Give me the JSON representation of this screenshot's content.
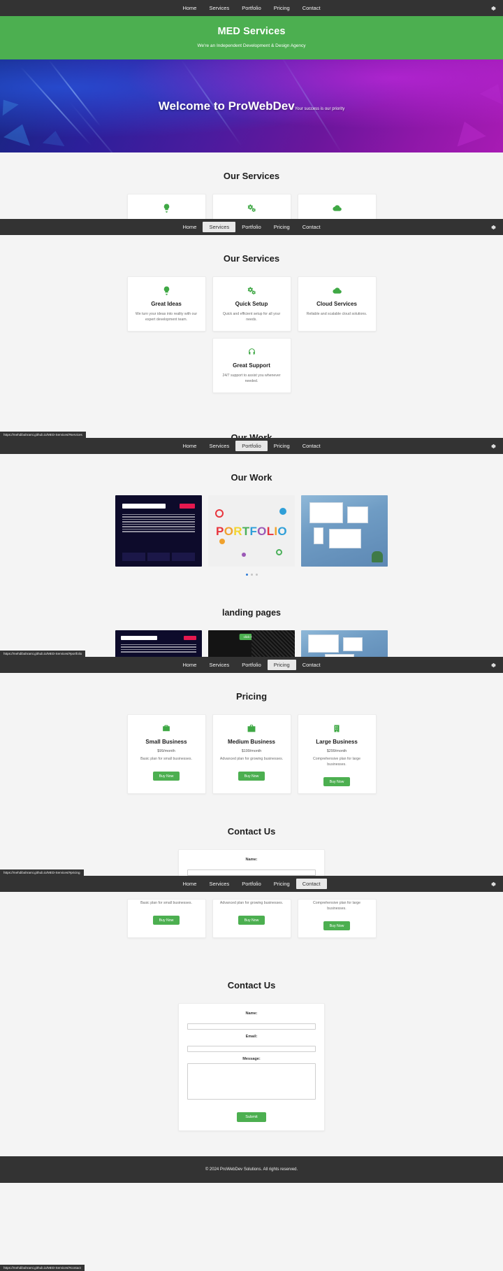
{
  "nav": {
    "items": [
      {
        "label": "Home"
      },
      {
        "label": "Services"
      },
      {
        "label": "Portfolio"
      },
      {
        "label": "Pricing"
      },
      {
        "label": "Contact"
      }
    ],
    "gear_icon": "gear-icon"
  },
  "header": {
    "title": "MED Services",
    "tagline": "We're an Independent Development & Design Agency"
  },
  "hero": {
    "title": "Welcome to ProWebDev",
    "subtitle": "Your success is our priority"
  },
  "services": {
    "title": "Our Services",
    "cards": [
      {
        "icon": "lightbulb-icon",
        "title": "Great Ideas",
        "text": "We turn your ideas into reality with our expert development team."
      },
      {
        "icon": "gears-icon",
        "title": "Quick Setup",
        "text": "Quick and efficient setup for all your needs."
      },
      {
        "icon": "cloud-icon",
        "title": "Cloud Services",
        "text": "Reliable and scalable cloud solutions."
      },
      {
        "icon": "headset-icon",
        "title": "Great Support",
        "text": "24/7 support to assist you whenever needed."
      }
    ]
  },
  "portfolio": {
    "title": "Our Work",
    "landing_title": "landing pages",
    "items": [
      {
        "name": "dark-website-thumbnail"
      },
      {
        "name": "portfolio-letters-thumbnail"
      },
      {
        "name": "desk-devices-thumbnail"
      }
    ],
    "carousel_dots": 3,
    "active_dot": 0,
    "landing_overlay_label": "click to see"
  },
  "pricing": {
    "title": "Pricing",
    "plans": [
      {
        "icon": "briefcase-icon",
        "name": "Small Business",
        "price": "$99/month",
        "desc": "Basic plan for small businesses.",
        "cta": "Buy Now"
      },
      {
        "icon": "suitcase-icon",
        "name": "Medium Business",
        "price": "$199/month",
        "desc": "Advanced plan for growing businesses.",
        "cta": "Buy Now"
      },
      {
        "icon": "building-icon",
        "name": "Large Business",
        "price": "$299/month",
        "desc": "Comprehensive plan for large businesses.",
        "cta": "Buy Now"
      }
    ]
  },
  "contact": {
    "title": "Contact Us",
    "name_label": "Name:",
    "email_label": "Email:",
    "message_label": "Message:",
    "name_value": "",
    "email_value": "",
    "message_value": "",
    "submit": "Submit"
  },
  "footer": {
    "text": "© 2024 ProWebDev Solutions. All rights reserved."
  },
  "status_bars": [
    {
      "url": "https://mehdibahrami.github.io/MED-Services/#services"
    },
    {
      "url": "https://mehdibahrami.github.io/MED-Services/#portfolio"
    },
    {
      "url": "https://mehdibahrami.github.io/MED-Services/#pricing"
    },
    {
      "url": "https://mehdibahrami.github.io/MED-Services/#contact"
    }
  ],
  "colors": {
    "nav_bg": "#333333",
    "brand_green": "#4caf50",
    "icon_green": "#3fa845",
    "page_bg": "#f4f4f4"
  }
}
